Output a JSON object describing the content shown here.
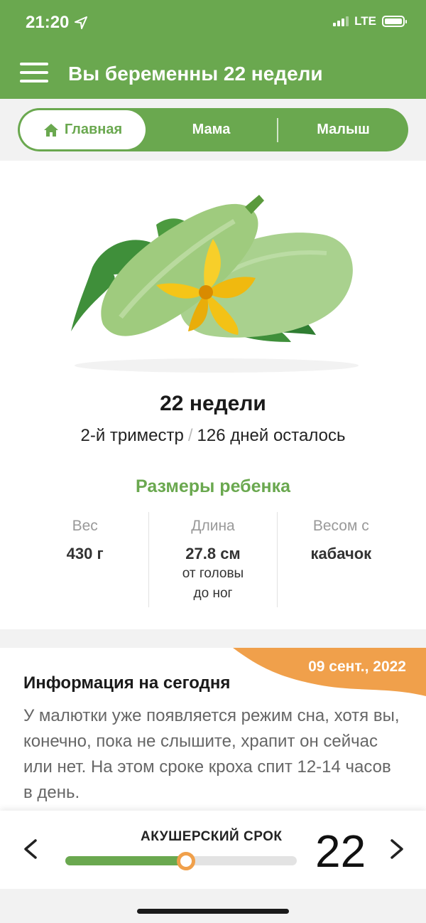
{
  "status_bar": {
    "time": "21:20",
    "network": "LTE"
  },
  "header": {
    "title": "Вы беременны 22 недели",
    "menu_icon": "hamburger-menu-icon"
  },
  "tabs": [
    {
      "label": "Главная",
      "icon": "home-icon",
      "active": true
    },
    {
      "label": "Мама",
      "active": false
    },
    {
      "label": "Малыш",
      "active": false
    }
  ],
  "week_card": {
    "image": "zucchini-with-flower",
    "weeks_title": "22 недели",
    "trimester": "2-й триместр",
    "separator": "/",
    "days_left": "126 дней осталось",
    "sizes_title": "Размеры ребенка",
    "stats": [
      {
        "label": "Вес",
        "value": "430 г",
        "sub1": "",
        "sub2": ""
      },
      {
        "label": "Длина",
        "value": "27.8 см",
        "sub1": "от головы",
        "sub2": "до ног"
      },
      {
        "label": "Весом с",
        "value": "кабачок",
        "sub1": "",
        "sub2": ""
      }
    ]
  },
  "info": {
    "date": "09 сент., 2022",
    "title": "Информация на сегодня",
    "text": "У малютки уже появляется режим сна, хотя вы, конечно, пока не слышите, храпит он сейчас или нет. На этом сроке кроха спит 12-14 часов в день."
  },
  "bottom_bar": {
    "term_label": "АКУШЕРСКИЙ СРОК",
    "week_number": "22",
    "progress_fraction": 0.52
  },
  "colors": {
    "green": "#6aa84f",
    "orange": "#f0a04b"
  }
}
